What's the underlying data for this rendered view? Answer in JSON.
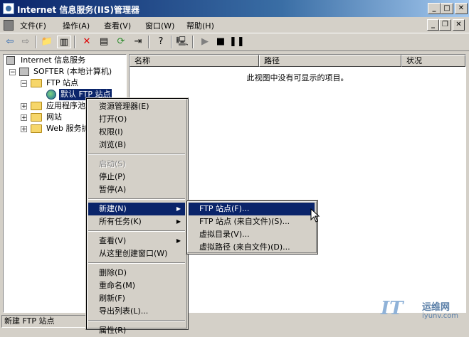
{
  "window": {
    "title": "Internet 信息服务(IIS)管理器"
  },
  "menubar": {
    "items": [
      "文件(F)",
      "操作(A)",
      "查看(V)",
      "窗口(W)",
      "帮助(H)"
    ]
  },
  "toolbar": {
    "icons": [
      "back-arrow-icon",
      "forward-arrow-icon",
      "up-folder-icon",
      "show-hide-tree-icon",
      "delete-icon",
      "properties-icon",
      "refresh-icon",
      "export-list-icon",
      "help-icon",
      "computer-icon",
      "play-icon",
      "stop-icon",
      "pause-icon"
    ]
  },
  "tree": {
    "root": "Internet 信息服务",
    "computer": "SOFTER (本地计算机)",
    "ftp_sites": "FTP 站点",
    "default_ftp": "默认 FTP 站点",
    "app_pools": "应用程序池",
    "websites": "网站",
    "web_ext": "Web 服务扩展"
  },
  "list": {
    "columns": [
      "名称",
      "路径",
      "状况"
    ],
    "empty_message": "此视图中没有可显示的项目。"
  },
  "status": {
    "text": "新建 FTP 站点"
  },
  "context_menu": {
    "groups": [
      [
        "资源管理器(E)",
        "打开(O)",
        "权限(I)",
        "浏览(B)"
      ],
      [
        "启动(S)",
        "停止(P)",
        "暂停(A)"
      ],
      [
        "新建(N)",
        "所有任务(K)"
      ],
      [
        "查看(V)",
        "从这里创建窗口(W)"
      ],
      [
        "删除(D)",
        "重命名(M)",
        "刷新(F)",
        "导出列表(L)..."
      ],
      [
        "属性(R)"
      ]
    ]
  },
  "submenu": {
    "items": [
      "FTP 站点(F)...",
      "FTP 站点 (来自文件)(S)...",
      "虚拟目录(V)...",
      "虚拟路径 (来自文件)(D)..."
    ]
  },
  "watermark": {
    "name": "运维网",
    "url": "iyunv.com"
  },
  "colors": {
    "selection": "#0a246a",
    "titlebar_start": "#0a246a",
    "face": "#d4d0c8"
  }
}
